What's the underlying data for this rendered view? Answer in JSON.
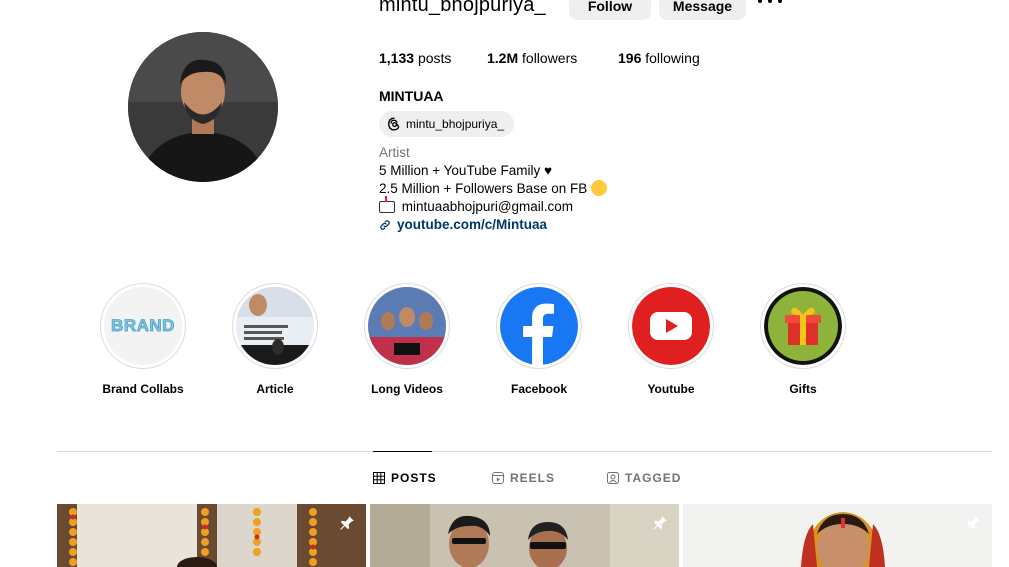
{
  "profile": {
    "username": "mintu_bhojpuriya_",
    "follow_label": "Follow",
    "message_label": "Message",
    "posts_count": "1,133",
    "posts_word": "posts",
    "followers_count": "1.2M",
    "followers_word": "followers",
    "following_count": "196",
    "following_word": "following",
    "full_name": "MINTUAA",
    "threads_handle": "mintu_bhojpuriya_",
    "category": "Artist",
    "bio_line1": "5 Million + YouTube Family",
    "bio_line2": "2.5 Million + Followers Base on FB",
    "email": "mintuaabhojpuri@gmail.com",
    "link": "youtube.com/c/Mintuaa"
  },
  "highlights": [
    {
      "label": "Brand Collabs"
    },
    {
      "label": "Article"
    },
    {
      "label": "Long Videos"
    },
    {
      "label": "Facebook"
    },
    {
      "label": "Youtube"
    },
    {
      "label": "Gifts"
    }
  ],
  "highlight_text": {
    "brand": "BRAND"
  },
  "tabs": [
    {
      "label": "POSTS",
      "active": true
    },
    {
      "label": "REELS",
      "active": false
    },
    {
      "label": "TAGGED",
      "active": false
    }
  ],
  "colors": {
    "link": "#00376b",
    "button_bg": "#efefef",
    "muted": "#737373",
    "facebook": "#1877f2",
    "youtube": "#e02020",
    "gifts_bg": "#8db33a"
  }
}
